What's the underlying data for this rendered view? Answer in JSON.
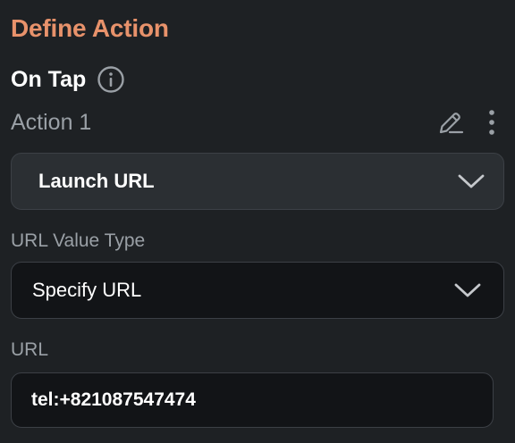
{
  "section_title": "Define Action",
  "trigger": {
    "label": "On Tap",
    "info_icon": "info-icon"
  },
  "action": {
    "label": "Action 1",
    "edit_icon": "edit-icon",
    "more_icon": "more-vertical-icon"
  },
  "action_type": {
    "selected": "Launch URL",
    "icon": "chevron-down-icon"
  },
  "url_value_type": {
    "label": "URL Value Type",
    "selected": "Specify URL",
    "icon": "chevron-down-icon"
  },
  "url_field": {
    "label": "URL",
    "value": "tel:+821087547474"
  },
  "colors": {
    "background": "#1e2124",
    "title_accent": "#e8926b",
    "muted_text": "#9aa0a6",
    "field_border": "#3c4046"
  }
}
